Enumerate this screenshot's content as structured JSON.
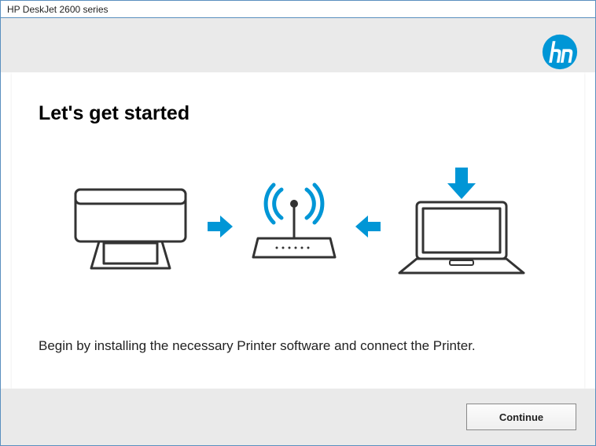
{
  "window": {
    "title": "HP DeskJet 2600 series"
  },
  "logo": {
    "name": "hp"
  },
  "heading": "Let's get started",
  "illustration": {
    "printer": "printer-icon",
    "arrow_right": "arrow-right-icon",
    "router": "router-icon",
    "arrow_left": "arrow-left-icon",
    "arrow_down": "arrow-down-icon",
    "laptop": "laptop-icon"
  },
  "description": "Begin by installing the necessary Printer software and connect the Printer.",
  "buttons": {
    "continue": "Continue"
  },
  "colors": {
    "accent": "#0096d6",
    "stroke": "#333333"
  }
}
